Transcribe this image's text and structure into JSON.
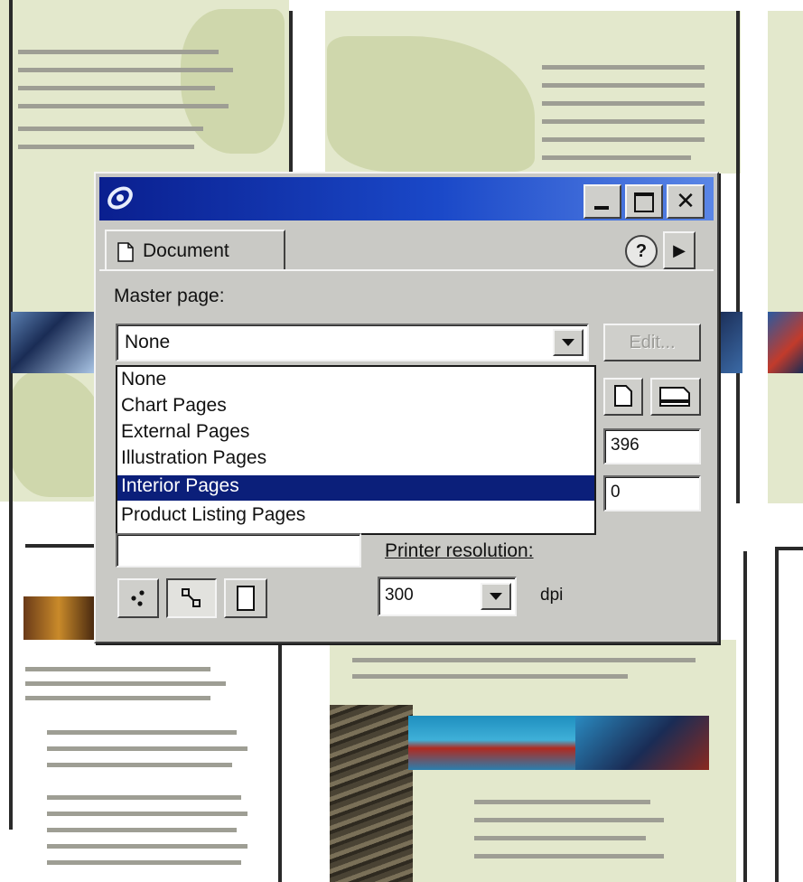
{
  "dialog": {
    "tab_label": "Document",
    "help_symbol": "?",
    "flyout_symbol": "▶",
    "master_page_label": "Master page:",
    "master_page_value": "None",
    "edit_button_label": "Edit...",
    "options": [
      "None",
      "Chart Pages",
      "External Pages",
      "Illustration Pages",
      "Interior Pages",
      "Product Listing Pages"
    ],
    "selected_option_index": 4,
    "field_value_1": "396",
    "field_value_2": "0",
    "printer_resolution_label": "Printer resolution:",
    "printer_resolution_value": "300",
    "dpi_label": "dpi"
  },
  "icons": {
    "app": "app-logo-icon",
    "minimize": "minimize-icon",
    "maximize": "maximize-icon",
    "close": "close-icon",
    "document_tab": "document-icon",
    "help": "help-icon",
    "flyout": "flyout-arrow-icon",
    "dropdown": "chevron-down-icon",
    "page_portrait": "portrait-page-icon",
    "page_landscape": "landscape-page-icon",
    "view_1": "scatter-view-icon",
    "view_2": "connected-view-icon",
    "view_3": "single-page-icon"
  },
  "colors": {
    "titlebar_start": "#0a1f8f",
    "titlebar_end": "#5a86e6",
    "selection": "#0b1f7a",
    "dialog_face": "#c9c9c5",
    "page_tint": "#e3e8cc"
  }
}
